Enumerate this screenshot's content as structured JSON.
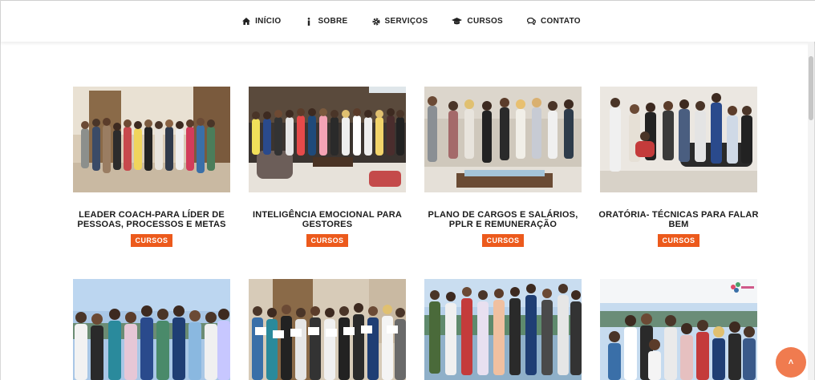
{
  "nav": {
    "items": [
      {
        "label": "INÍCIO",
        "icon": "home-icon"
      },
      {
        "label": "SOBRE",
        "icon": "info-icon"
      },
      {
        "label": "SERVIÇOS",
        "icon": "gear-icon"
      },
      {
        "label": "CURSOS",
        "icon": "graduation-cap-icon"
      },
      {
        "label": "CONTATO",
        "icon": "chat-bubbles-icon"
      }
    ]
  },
  "cards": [
    {
      "title": "LEADER COACH-PARA LÍDER DE PESSOAS, PROCESSOS E METAS",
      "tag": "CURSOS"
    },
    {
      "title": "INTELIGÊNCIA EMOCIONAL PARA GESTORES",
      "tag": "CURSOS"
    },
    {
      "title": "PLANO DE CARGOS E SALÁRIOS, PPLR E REMUNERAÇÃO",
      "tag": "CURSOS"
    },
    {
      "title": "ORATÓRIA- TÉCNICAS PARA FALAR BEM",
      "tag": "CURSOS"
    }
  ],
  "back_to_top": {
    "glyph": "˄"
  },
  "colors": {
    "accent": "#ec5a1c",
    "back_to_top": "#f07b4f"
  }
}
